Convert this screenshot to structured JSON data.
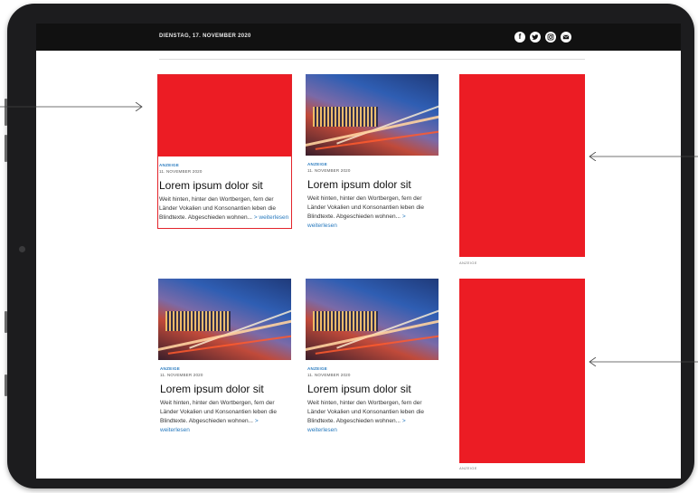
{
  "header": {
    "date": "DIENSTAG, 17. NOVEMBER 2020",
    "social_icons": [
      "facebook-icon",
      "twitter-icon",
      "instagram-icon",
      "mail-icon"
    ]
  },
  "articles": [
    {
      "image": "red-placeholder",
      "tag": "ANZEIGE",
      "date": "11. NOVEMBER 2020",
      "title": "Lorem ipsum dolor sit",
      "text": "Weit hinten, hinter den Wortbergen, fern der Länder Vokalien und Konsonantien leben die Blindtexte. Abgeschieden wohnen...",
      "more": "> weiterlesen"
    },
    {
      "image": "city-night-photo",
      "tag": "ANZEIGE",
      "date": "11. NOVEMBER 2020",
      "title": "Lorem ipsum dolor sit",
      "text": "Weit hinten, hinter den Wortbergen, fern der Länder Vokalien und Konsonantien leben die Blindtexte. Abgeschieden wohnen...",
      "more": "> weiterlesen"
    },
    {
      "image": "city-night-photo",
      "tag": "ANZEIGE",
      "date": "11. NOVEMBER 2020",
      "title": "Lorem ipsum dolor sit",
      "text": "Weit hinten, hinter den Wortbergen, fern der Länder Vokalien und Konsonantien leben die Blindtexte. Abgeschieden wohnen...",
      "more": "> weiterlesen"
    },
    {
      "image": "city-night-photo",
      "tag": "ANZEIGE",
      "date": "11. NOVEMBER 2020",
      "title": "Lorem ipsum dolor sit",
      "text": "Weit hinten, hinter den Wortbergen, fern der Länder Vokalien und Konsonantien leben die Blindtexte. Abgeschieden wohnen...",
      "more": "> weiterlesen"
    }
  ],
  "ads": [
    {
      "label": "ANZEIGE"
    },
    {
      "label": "ANZEIGE"
    }
  ],
  "colors": {
    "ad_red": "#ec1c24",
    "topbar": "#111111",
    "link_blue": "#2a7bbf"
  }
}
